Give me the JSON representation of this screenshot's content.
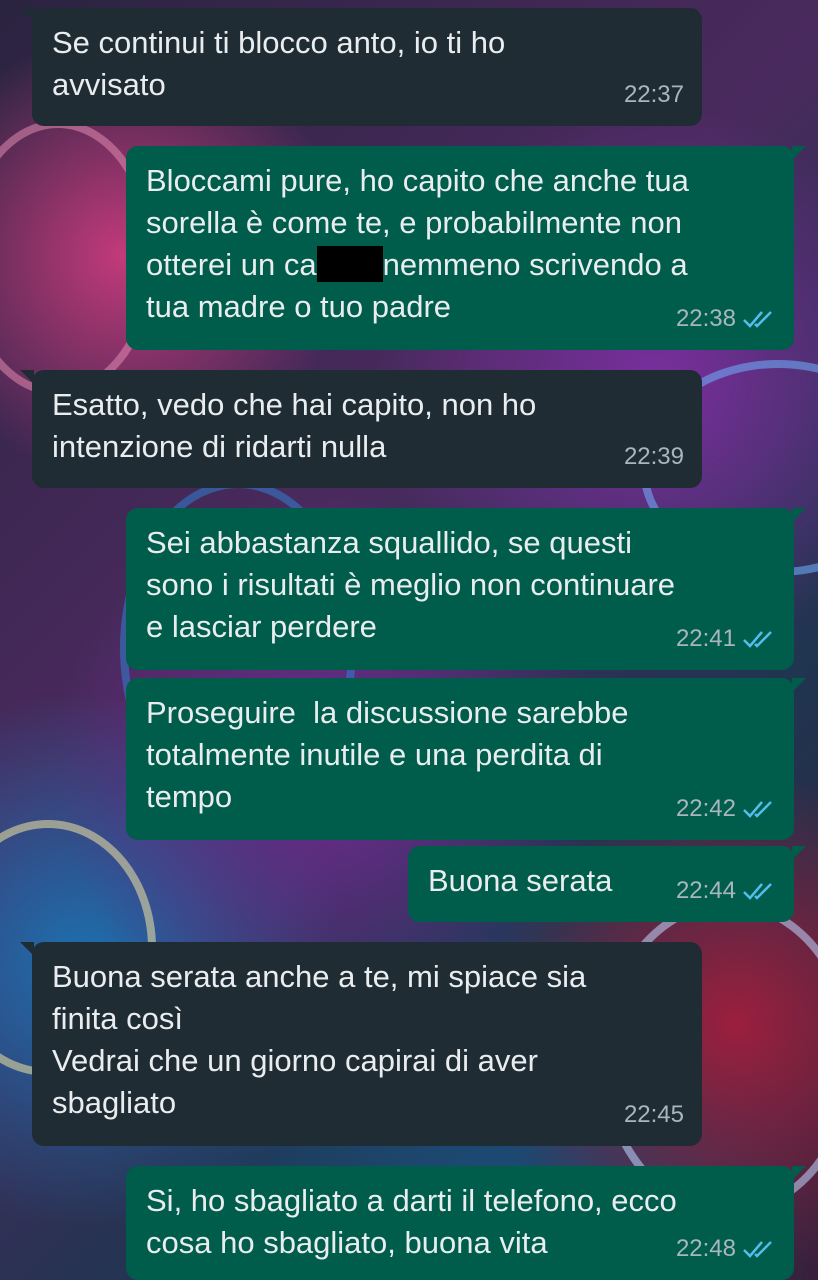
{
  "messages": [
    {
      "dir": "in",
      "text": "Se continui ti blocco anto, io ti ho\navvisato",
      "time": "22:37"
    },
    {
      "dir": "out",
      "text_before": "Bloccami pure, ho capito che anche tua\nsorella è come te, e probabilmente non\notterei un ca",
      "text_after": "nemmeno scrivendo a\ntua madre o tuo padre",
      "time": "22:38",
      "status": "read"
    },
    {
      "dir": "in",
      "text": "Esatto, vedo che hai capito, non ho\nintenzione di ridarti nulla",
      "time": "22:39"
    },
    {
      "dir": "out",
      "text": "Sei abbastanza squallido, se questi\nsono i risultati è meglio non continuare\ne lasciar perdere",
      "time": "22:41",
      "status": "read"
    },
    {
      "dir": "out",
      "text": "Proseguire  la discussione sarebbe\ntotalmente inutile e una perdita di\ntempo",
      "time": "22:42",
      "status": "read"
    },
    {
      "dir": "out",
      "text": "Buona serata",
      "time": "22:44",
      "status": "read"
    },
    {
      "dir": "in",
      "text": "Buona serata anche a te, mi spiace sia\nfinita così\nVedrai che un giorno capirai di aver\nsbagliato",
      "time": "22:45"
    },
    {
      "dir": "out",
      "text": "Si, ho sbagliato a darti il telefono, ecco\ncosa ho sbagliato, buona vita",
      "time": "22:48",
      "status": "read"
    }
  ],
  "colors": {
    "incoming": "#202c33",
    "outgoing": "#005c4b",
    "read_ticks": "#53bdeb",
    "meta_text": "#a8b6bd"
  },
  "icons": {
    "read_status": "double-check-icon"
  }
}
